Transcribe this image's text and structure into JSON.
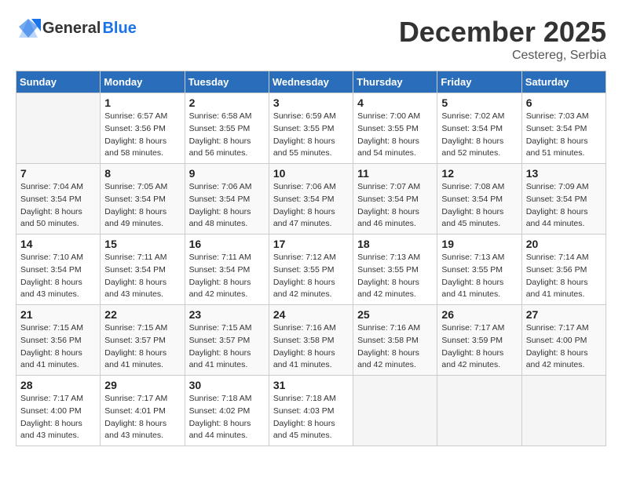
{
  "header": {
    "logo_general": "General",
    "logo_blue": "Blue",
    "month_title": "December 2025",
    "location": "Cestereg, Serbia"
  },
  "weekdays": [
    "Sunday",
    "Monday",
    "Tuesday",
    "Wednesday",
    "Thursday",
    "Friday",
    "Saturday"
  ],
  "weeks": [
    [
      {
        "day": "",
        "sunrise": "",
        "sunset": "",
        "daylight": ""
      },
      {
        "day": "1",
        "sunrise": "Sunrise: 6:57 AM",
        "sunset": "Sunset: 3:56 PM",
        "daylight": "Daylight: 8 hours and 58 minutes."
      },
      {
        "day": "2",
        "sunrise": "Sunrise: 6:58 AM",
        "sunset": "Sunset: 3:55 PM",
        "daylight": "Daylight: 8 hours and 56 minutes."
      },
      {
        "day": "3",
        "sunrise": "Sunrise: 6:59 AM",
        "sunset": "Sunset: 3:55 PM",
        "daylight": "Daylight: 8 hours and 55 minutes."
      },
      {
        "day": "4",
        "sunrise": "Sunrise: 7:00 AM",
        "sunset": "Sunset: 3:55 PM",
        "daylight": "Daylight: 8 hours and 54 minutes."
      },
      {
        "day": "5",
        "sunrise": "Sunrise: 7:02 AM",
        "sunset": "Sunset: 3:54 PM",
        "daylight": "Daylight: 8 hours and 52 minutes."
      },
      {
        "day": "6",
        "sunrise": "Sunrise: 7:03 AM",
        "sunset": "Sunset: 3:54 PM",
        "daylight": "Daylight: 8 hours and 51 minutes."
      }
    ],
    [
      {
        "day": "7",
        "sunrise": "Sunrise: 7:04 AM",
        "sunset": "Sunset: 3:54 PM",
        "daylight": "Daylight: 8 hours and 50 minutes."
      },
      {
        "day": "8",
        "sunrise": "Sunrise: 7:05 AM",
        "sunset": "Sunset: 3:54 PM",
        "daylight": "Daylight: 8 hours and 49 minutes."
      },
      {
        "day": "9",
        "sunrise": "Sunrise: 7:06 AM",
        "sunset": "Sunset: 3:54 PM",
        "daylight": "Daylight: 8 hours and 48 minutes."
      },
      {
        "day": "10",
        "sunrise": "Sunrise: 7:06 AM",
        "sunset": "Sunset: 3:54 PM",
        "daylight": "Daylight: 8 hours and 47 minutes."
      },
      {
        "day": "11",
        "sunrise": "Sunrise: 7:07 AM",
        "sunset": "Sunset: 3:54 PM",
        "daylight": "Daylight: 8 hours and 46 minutes."
      },
      {
        "day": "12",
        "sunrise": "Sunrise: 7:08 AM",
        "sunset": "Sunset: 3:54 PM",
        "daylight": "Daylight: 8 hours and 45 minutes."
      },
      {
        "day": "13",
        "sunrise": "Sunrise: 7:09 AM",
        "sunset": "Sunset: 3:54 PM",
        "daylight": "Daylight: 8 hours and 44 minutes."
      }
    ],
    [
      {
        "day": "14",
        "sunrise": "Sunrise: 7:10 AM",
        "sunset": "Sunset: 3:54 PM",
        "daylight": "Daylight: 8 hours and 43 minutes."
      },
      {
        "day": "15",
        "sunrise": "Sunrise: 7:11 AM",
        "sunset": "Sunset: 3:54 PM",
        "daylight": "Daylight: 8 hours and 43 minutes."
      },
      {
        "day": "16",
        "sunrise": "Sunrise: 7:11 AM",
        "sunset": "Sunset: 3:54 PM",
        "daylight": "Daylight: 8 hours and 42 minutes."
      },
      {
        "day": "17",
        "sunrise": "Sunrise: 7:12 AM",
        "sunset": "Sunset: 3:55 PM",
        "daylight": "Daylight: 8 hours and 42 minutes."
      },
      {
        "day": "18",
        "sunrise": "Sunrise: 7:13 AM",
        "sunset": "Sunset: 3:55 PM",
        "daylight": "Daylight: 8 hours and 42 minutes."
      },
      {
        "day": "19",
        "sunrise": "Sunrise: 7:13 AM",
        "sunset": "Sunset: 3:55 PM",
        "daylight": "Daylight: 8 hours and 41 minutes."
      },
      {
        "day": "20",
        "sunrise": "Sunrise: 7:14 AM",
        "sunset": "Sunset: 3:56 PM",
        "daylight": "Daylight: 8 hours and 41 minutes."
      }
    ],
    [
      {
        "day": "21",
        "sunrise": "Sunrise: 7:15 AM",
        "sunset": "Sunset: 3:56 PM",
        "daylight": "Daylight: 8 hours and 41 minutes."
      },
      {
        "day": "22",
        "sunrise": "Sunrise: 7:15 AM",
        "sunset": "Sunset: 3:57 PM",
        "daylight": "Daylight: 8 hours and 41 minutes."
      },
      {
        "day": "23",
        "sunrise": "Sunrise: 7:15 AM",
        "sunset": "Sunset: 3:57 PM",
        "daylight": "Daylight: 8 hours and 41 minutes."
      },
      {
        "day": "24",
        "sunrise": "Sunrise: 7:16 AM",
        "sunset": "Sunset: 3:58 PM",
        "daylight": "Daylight: 8 hours and 41 minutes."
      },
      {
        "day": "25",
        "sunrise": "Sunrise: 7:16 AM",
        "sunset": "Sunset: 3:58 PM",
        "daylight": "Daylight: 8 hours and 42 minutes."
      },
      {
        "day": "26",
        "sunrise": "Sunrise: 7:17 AM",
        "sunset": "Sunset: 3:59 PM",
        "daylight": "Daylight: 8 hours and 42 minutes."
      },
      {
        "day": "27",
        "sunrise": "Sunrise: 7:17 AM",
        "sunset": "Sunset: 4:00 PM",
        "daylight": "Daylight: 8 hours and 42 minutes."
      }
    ],
    [
      {
        "day": "28",
        "sunrise": "Sunrise: 7:17 AM",
        "sunset": "Sunset: 4:00 PM",
        "daylight": "Daylight: 8 hours and 43 minutes."
      },
      {
        "day": "29",
        "sunrise": "Sunrise: 7:17 AM",
        "sunset": "Sunset: 4:01 PM",
        "daylight": "Daylight: 8 hours and 43 minutes."
      },
      {
        "day": "30",
        "sunrise": "Sunrise: 7:18 AM",
        "sunset": "Sunset: 4:02 PM",
        "daylight": "Daylight: 8 hours and 44 minutes."
      },
      {
        "day": "31",
        "sunrise": "Sunrise: 7:18 AM",
        "sunset": "Sunset: 4:03 PM",
        "daylight": "Daylight: 8 hours and 45 minutes."
      },
      {
        "day": "",
        "sunrise": "",
        "sunset": "",
        "daylight": ""
      },
      {
        "day": "",
        "sunrise": "",
        "sunset": "",
        "daylight": ""
      },
      {
        "day": "",
        "sunrise": "",
        "sunset": "",
        "daylight": ""
      }
    ]
  ]
}
